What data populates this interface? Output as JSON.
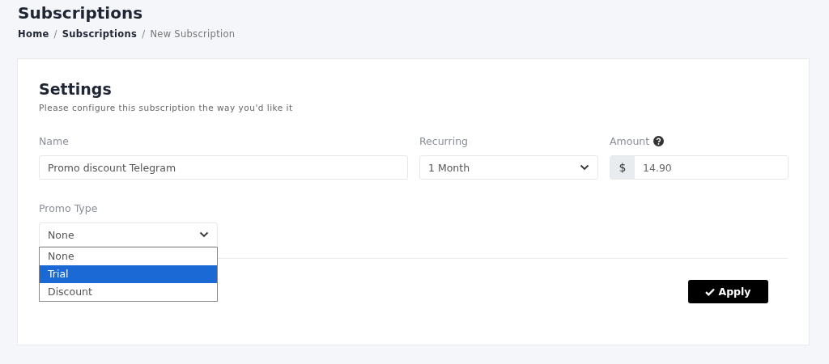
{
  "page": {
    "title": "Subscriptions"
  },
  "breadcrumb": [
    {
      "label": "Home",
      "current": false
    },
    {
      "label": "Subscriptions",
      "current": false
    },
    {
      "label": "New Subscription",
      "current": true
    }
  ],
  "breadcrumb_separator": "/",
  "card": {
    "title": "Settings",
    "subtitle": "Please configure this subscription the way you'd like it",
    "name": {
      "label": "Name",
      "value": "Promo discount Telegram"
    },
    "recurring": {
      "label": "Recurring",
      "value": "1 Month"
    },
    "amount": {
      "label": "Amount",
      "prefix": "$",
      "value": "14.90"
    },
    "promo_type": {
      "label": "Promo Type",
      "value": "None",
      "expanded": true,
      "options": [
        {
          "label": "None",
          "highlighted": false
        },
        {
          "label": "Trial",
          "highlighted": true
        },
        {
          "label": "Discount",
          "highlighted": false
        }
      ]
    },
    "apply_button": "Apply"
  }
}
